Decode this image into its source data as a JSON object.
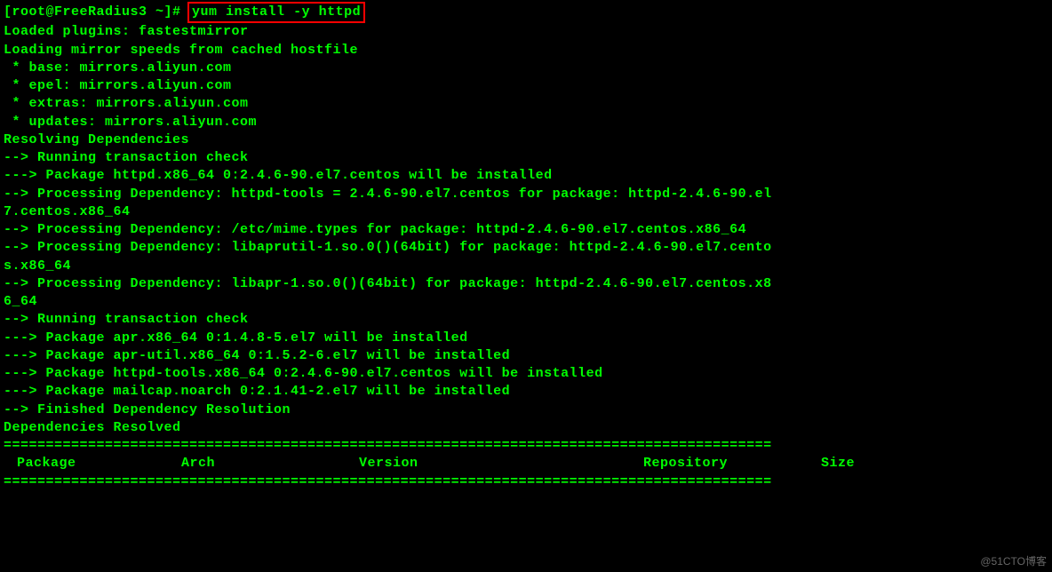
{
  "prompt": {
    "prefix": "[root@FreeRadius3 ~]#",
    "command": "yum install -y httpd"
  },
  "output": {
    "line1": "Loaded plugins: fastestmirror",
    "line2": "Loading mirror speeds from cached hostfile",
    "line3": " * base: mirrors.aliyun.com",
    "line4": " * epel: mirrors.aliyun.com",
    "line5": " * extras: mirrors.aliyun.com",
    "line6": " * updates: mirrors.aliyun.com",
    "line7": "Resolving Dependencies",
    "line8": "--> Running transaction check",
    "line9": "---> Package httpd.x86_64 0:2.4.6-90.el7.centos will be installed",
    "line10": "--> Processing Dependency: httpd-tools = 2.4.6-90.el7.centos for package: httpd-2.4.6-90.el",
    "line11": "7.centos.x86_64",
    "line12": "--> Processing Dependency: /etc/mime.types for package: httpd-2.4.6-90.el7.centos.x86_64",
    "line13": "--> Processing Dependency: libaprutil-1.so.0()(64bit) for package: httpd-2.4.6-90.el7.cento",
    "line14": "s.x86_64",
    "line15": "--> Processing Dependency: libapr-1.so.0()(64bit) for package: httpd-2.4.6-90.el7.centos.x8",
    "line16": "6_64",
    "line17": "--> Running transaction check",
    "line18": "---> Package apr.x86_64 0:1.4.8-5.el7 will be installed",
    "line19": "---> Package apr-util.x86_64 0:1.5.2-6.el7 will be installed",
    "line20": "---> Package httpd-tools.x86_64 0:2.4.6-90.el7.centos will be installed",
    "line21": "---> Package mailcap.noarch 0:2.1.41-2.el7 will be installed",
    "line22": "--> Finished Dependency Resolution",
    "line23": "",
    "line24": "Dependencies Resolved",
    "line25": "",
    "separator": "===========================================================================================",
    "table": {
      "col_package": " Package",
      "col_arch": "Arch",
      "col_version": "Version",
      "col_repo": "Repository",
      "col_size": "Size"
    }
  },
  "watermark": "@51CTO博客"
}
